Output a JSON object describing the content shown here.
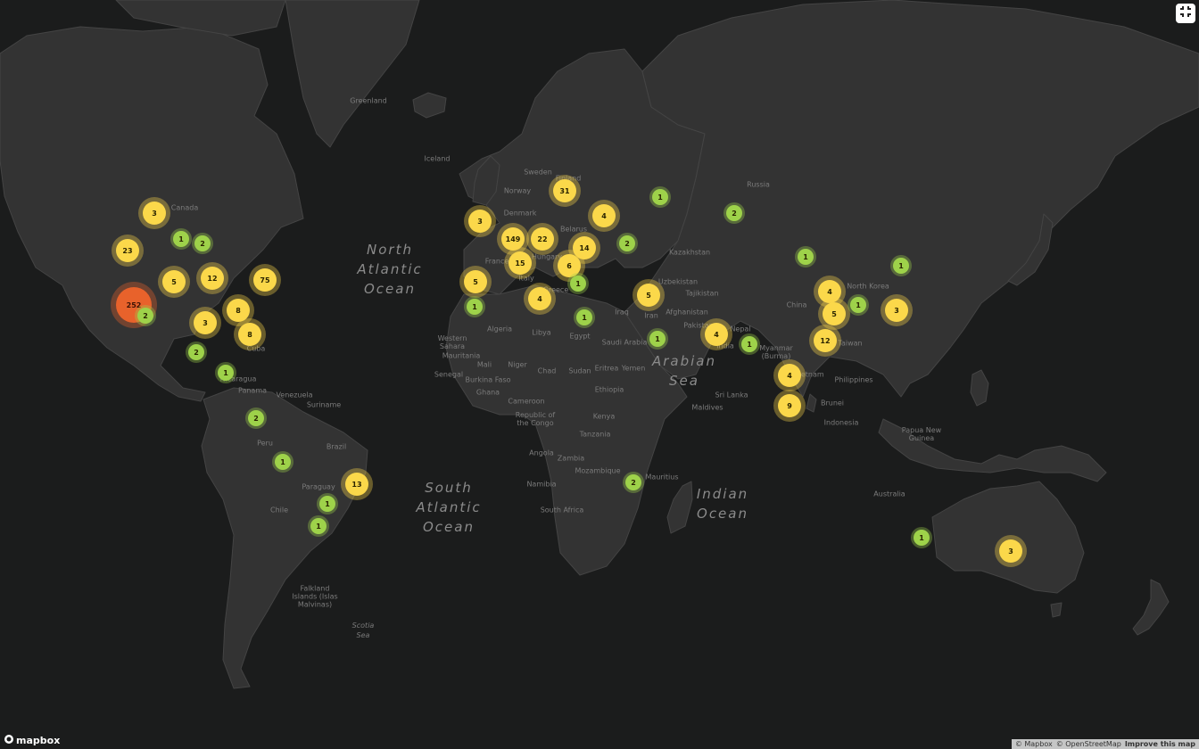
{
  "map": {
    "oceans": [
      {
        "name": "North\nAtlantic\nOcean",
        "lon": -34,
        "lat": 44
      },
      {
        "name": "South\nAtlantic\nOcean",
        "lon": -14,
        "lat": -29
      },
      {
        "name": "Indian\nOcean",
        "lon": 78,
        "lat": -28
      },
      {
        "name": "Arabian\nSea",
        "lon": 65,
        "lat": 15
      }
    ],
    "ocean_small": [
      {
        "name": "Scotia\nSea",
        "lon": -43,
        "lat": -58
      }
    ],
    "countries": [
      {
        "name": "Canada",
        "lon": -103,
        "lat": 57
      },
      {
        "name": "Greenland",
        "lon": -41,
        "lat": 72
      },
      {
        "name": "Iceland",
        "lon": -18,
        "lat": 65
      },
      {
        "name": "Sweden",
        "lon": 16,
        "lat": 63
      },
      {
        "name": "Finland",
        "lon": 26,
        "lat": 62
      },
      {
        "name": "Norway",
        "lon": 9,
        "lat": 60
      },
      {
        "name": "Denmark",
        "lon": 10,
        "lat": 56
      },
      {
        "name": "Belarus",
        "lon": 28,
        "lat": 53
      },
      {
        "name": "France",
        "lon": 2,
        "lat": 46
      },
      {
        "name": "Hungary",
        "lon": 19,
        "lat": 47
      },
      {
        "name": "Italy",
        "lon": 12,
        "lat": 42
      },
      {
        "name": "Greece",
        "lon": 22,
        "lat": 39
      },
      {
        "name": "Russia",
        "lon": 90,
        "lat": 61
      },
      {
        "name": "Kazakhstan",
        "lon": 67,
        "lat": 48
      },
      {
        "name": "Uzbekistan",
        "lon": 63,
        "lat": 41
      },
      {
        "name": "Tajikistan",
        "lon": 71,
        "lat": 38
      },
      {
        "name": "Afghanistan",
        "lon": 66,
        "lat": 33
      },
      {
        "name": "Pakistan",
        "lon": 70,
        "lat": 29
      },
      {
        "name": "Iran",
        "lon": 54,
        "lat": 32
      },
      {
        "name": "Iraq",
        "lon": 44,
        "lat": 33
      },
      {
        "name": "Saudi Arabia",
        "lon": 45,
        "lat": 24
      },
      {
        "name": "Yemen",
        "lon": 48,
        "lat": 16
      },
      {
        "name": "Algeria",
        "lon": 3,
        "lat": 28
      },
      {
        "name": "Libya",
        "lon": 17,
        "lat": 27
      },
      {
        "name": "Egypt",
        "lon": 30,
        "lat": 26
      },
      {
        "name": "Western\nSahara",
        "lon": -13,
        "lat": 24
      },
      {
        "name": "Mauritania",
        "lon": -10,
        "lat": 20
      },
      {
        "name": "Mali",
        "lon": -2,
        "lat": 17
      },
      {
        "name": "Niger",
        "lon": 9,
        "lat": 17
      },
      {
        "name": "Chad",
        "lon": 19,
        "lat": 15
      },
      {
        "name": "Sudan",
        "lon": 30,
        "lat": 15
      },
      {
        "name": "Eritrea",
        "lon": 39,
        "lat": 16
      },
      {
        "name": "Senegal",
        "lon": -14,
        "lat": 14
      },
      {
        "name": "Burkina Faso",
        "lon": -1,
        "lat": 12
      },
      {
        "name": "Ghana",
        "lon": -1,
        "lat": 8
      },
      {
        "name": "Ethiopia",
        "lon": 40,
        "lat": 9
      },
      {
        "name": "Cameroon",
        "lon": 12,
        "lat": 5
      },
      {
        "name": "Republic of\nthe Congo",
        "lon": 15,
        "lat": -1
      },
      {
        "name": "Kenya",
        "lon": 38,
        "lat": 0
      },
      {
        "name": "Tanzania",
        "lon": 35,
        "lat": -6
      },
      {
        "name": "Angola",
        "lon": 17,
        "lat": -12
      },
      {
        "name": "Zambia",
        "lon": 27,
        "lat": -14
      },
      {
        "name": "Mozambique",
        "lon": 36,
        "lat": -18
      },
      {
        "name": "Namibia",
        "lon": 17,
        "lat": -22
      },
      {
        "name": "South Africa",
        "lon": 24,
        "lat": -30
      },
      {
        "name": "Mauritius",
        "lon": 57.5,
        "lat": -20
      },
      {
        "name": "India",
        "lon": 79,
        "lat": 23
      },
      {
        "name": "Nepal",
        "lon": 84,
        "lat": 28
      },
      {
        "name": "Sri Lanka",
        "lon": 81,
        "lat": 7
      },
      {
        "name": "Maldives",
        "lon": 73,
        "lat": 3
      },
      {
        "name": "Myanmar\n(Burma)",
        "lon": 96,
        "lat": 21
      },
      {
        "name": "China",
        "lon": 103,
        "lat": 35
      },
      {
        "name": "North Korea",
        "lon": 127,
        "lat": 40
      },
      {
        "name": "Taiwan",
        "lon": 121,
        "lat": 23.7
      },
      {
        "name": "Vietnam",
        "lon": 107,
        "lat": 14
      },
      {
        "name": "Philippines",
        "lon": 122,
        "lat": 12
      },
      {
        "name": "Brunei",
        "lon": 115,
        "lat": 4.5
      },
      {
        "name": "Indonesia",
        "lon": 118,
        "lat": -2
      },
      {
        "name": "Papua New\nGuinea",
        "lon": 145,
        "lat": -6
      },
      {
        "name": "Australia",
        "lon": 134,
        "lat": -25
      },
      {
        "name": "Cuba",
        "lon": -79,
        "lat": 22
      },
      {
        "name": "Nicaragua",
        "lon": -85,
        "lat": 12.5
      },
      {
        "name": "Panama",
        "lon": -80,
        "lat": 8.5
      },
      {
        "name": "Venezuela",
        "lon": -66,
        "lat": 7
      },
      {
        "name": "Suriname",
        "lon": -56,
        "lat": 4
      },
      {
        "name": "Peru",
        "lon": -76,
        "lat": -9
      },
      {
        "name": "Brazil",
        "lon": -52,
        "lat": -10
      },
      {
        "name": "Paraguay",
        "lon": -58,
        "lat": -23
      },
      {
        "name": "Chile",
        "lon": -71,
        "lat": -30
      },
      {
        "name": "Falkland\nIslands (Islas\nMalvinas)",
        "lon": -59,
        "lat": -51.5
      }
    ],
    "clusters": [
      {
        "count": "252",
        "lon": -120,
        "lat": 35,
        "size": "large"
      },
      {
        "count": "23",
        "lon": -122,
        "lat": 48.5,
        "size": "medium"
      },
      {
        "count": "3",
        "lon": -113,
        "lat": 56,
        "size": "medium"
      },
      {
        "count": "1",
        "lon": -104,
        "lat": 51,
        "size": "small"
      },
      {
        "count": "2",
        "lon": -97,
        "lat": 50,
        "size": "small"
      },
      {
        "count": "5",
        "lon": -106.5,
        "lat": 41,
        "size": "medium"
      },
      {
        "count": "12",
        "lon": -93.5,
        "lat": 42,
        "size": "medium"
      },
      {
        "count": "75",
        "lon": -76,
        "lat": 41.5,
        "size": "medium"
      },
      {
        "count": "2",
        "lon": -116,
        "lat": 32,
        "size": "small"
      },
      {
        "count": "3",
        "lon": -96,
        "lat": 30,
        "size": "medium"
      },
      {
        "count": "8",
        "lon": -85,
        "lat": 33.5,
        "size": "medium"
      },
      {
        "count": "8",
        "lon": -81,
        "lat": 26.5,
        "size": "medium"
      },
      {
        "count": "2",
        "lon": -99,
        "lat": 21,
        "size": "small"
      },
      {
        "count": "1",
        "lon": -89,
        "lat": 14.5,
        "size": "small"
      },
      {
        "count": "2",
        "lon": -79,
        "lat": -0.5,
        "size": "small"
      },
      {
        "count": "1",
        "lon": -70,
        "lat": -15,
        "size": "small"
      },
      {
        "count": "13",
        "lon": -45,
        "lat": -22,
        "size": "medium"
      },
      {
        "count": "1",
        "lon": -55,
        "lat": -28,
        "size": "small"
      },
      {
        "count": "1",
        "lon": -58,
        "lat": -34.5,
        "size": "small"
      },
      {
        "count": "3",
        "lon": -3.5,
        "lat": 54.5,
        "size": "medium"
      },
      {
        "count": "149",
        "lon": 7.5,
        "lat": 51,
        "size": "medium"
      },
      {
        "count": "22",
        "lon": 17.5,
        "lat": 51,
        "size": "medium"
      },
      {
        "count": "31",
        "lon": 25,
        "lat": 60,
        "size": "medium"
      },
      {
        "count": "4",
        "lon": 38,
        "lat": 55.5,
        "size": "medium"
      },
      {
        "count": "14",
        "lon": 31.5,
        "lat": 49,
        "size": "medium"
      },
      {
        "count": "15",
        "lon": 10,
        "lat": 45.5,
        "size": "medium"
      },
      {
        "count": "6",
        "lon": 26.5,
        "lat": 45,
        "size": "medium"
      },
      {
        "count": "5",
        "lon": -5,
        "lat": 41,
        "size": "medium"
      },
      {
        "count": "1",
        "lon": -5.5,
        "lat": 34.5,
        "size": "small"
      },
      {
        "count": "4",
        "lon": 16.5,
        "lat": 36.5,
        "size": "medium"
      },
      {
        "count": "1",
        "lon": 29.5,
        "lat": 40.5,
        "size": "small"
      },
      {
        "count": "1",
        "lon": 31.5,
        "lat": 31.5,
        "size": "small"
      },
      {
        "count": "2",
        "lon": 46,
        "lat": 50,
        "size": "small"
      },
      {
        "count": "1",
        "lon": 57,
        "lat": 59,
        "size": "small"
      },
      {
        "count": "2",
        "lon": 82,
        "lat": 56,
        "size": "small"
      },
      {
        "count": "5",
        "lon": 53,
        "lat": 37.5,
        "size": "medium"
      },
      {
        "count": "1",
        "lon": 56,
        "lat": 25,
        "size": "small"
      },
      {
        "count": "4",
        "lon": 76,
        "lat": 26.5,
        "size": "medium"
      },
      {
        "count": "1",
        "lon": 87,
        "lat": 23.5,
        "size": "small"
      },
      {
        "count": "1",
        "lon": 106,
        "lat": 47,
        "size": "small"
      },
      {
        "count": "4",
        "lon": 114,
        "lat": 38.5,
        "size": "medium"
      },
      {
        "count": "5",
        "lon": 115.5,
        "lat": 32.5,
        "size": "medium"
      },
      {
        "count": "12",
        "lon": 112.5,
        "lat": 24.5,
        "size": "medium"
      },
      {
        "count": "1",
        "lon": 123.5,
        "lat": 35,
        "size": "small"
      },
      {
        "count": "3",
        "lon": 136.5,
        "lat": 33.5,
        "size": "medium"
      },
      {
        "count": "1",
        "lon": 138,
        "lat": 45,
        "size": "small"
      },
      {
        "count": "4",
        "lon": 100.5,
        "lat": 13.5,
        "size": "medium"
      },
      {
        "count": "9",
        "lon": 100.5,
        "lat": 3.5,
        "size": "medium"
      },
      {
        "count": "2",
        "lon": 48,
        "lat": -21.5,
        "size": "small"
      },
      {
        "count": "1",
        "lon": 145,
        "lat": -37.5,
        "size": "small"
      },
      {
        "count": "3",
        "lon": 175,
        "lat": -41,
        "size": "medium"
      }
    ]
  },
  "controls": {
    "logo_text": "mapbox",
    "attribution_mapbox": "© Mapbox",
    "attribution_osm": "© OpenStreetMap",
    "attribution_improve": "Improve this map"
  }
}
